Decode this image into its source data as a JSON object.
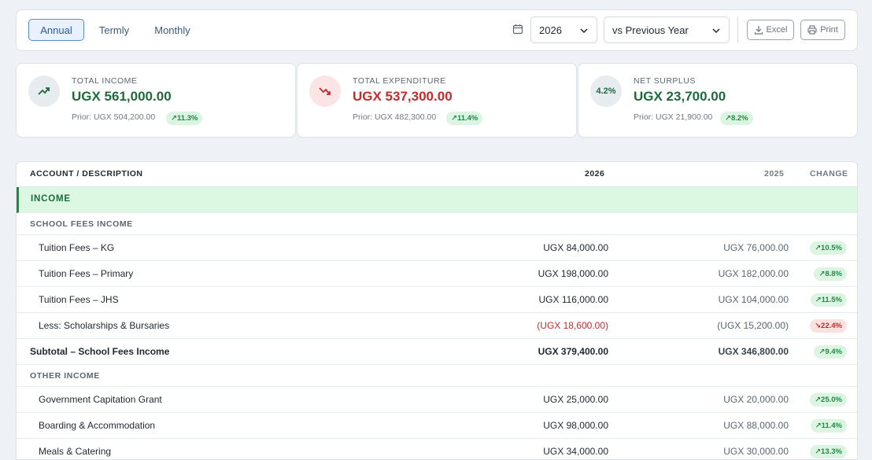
{
  "toolbar": {
    "periods": [
      "Annual",
      "Termly",
      "Monthly"
    ],
    "year": "2026",
    "compare": "vs Previous Year",
    "excel": "Excel",
    "print": "Print"
  },
  "cards": [
    {
      "label": "TOTAL INCOME",
      "amount": "UGX 561,000.00",
      "prior": "Prior: UGX 504,200.00",
      "change": "↗11.3%",
      "color": "#1f8a46"
    },
    {
      "label": "TOTAL EXPENDITURE",
      "amount": "UGX 537,300.00",
      "prior": "Prior: UGX 482,300.00",
      "change": "↗11.4%",
      "color": "#c8292d"
    },
    {
      "label": "NET SURPLUS",
      "circle_text": "4.2%",
      "amount": "UGX 23,700.00",
      "prior": "Prior: UGX 21,900.00",
      "change": "↗8.2%",
      "color": "#1f8a46"
    }
  ],
  "table": {
    "headers": {
      "account": "ACCOUNT / DESCRIPTION",
      "current": "2026",
      "previous": "2025",
      "change": "CHANGE"
    },
    "category": "INCOME",
    "groups": {
      "school_fees": "SCHOOL FEES INCOME",
      "other": "OTHER INCOME"
    },
    "rows": [
      {
        "name": "Tuition Fees – KG",
        "current": "UGX 84,000.00",
        "previous": "UGX 76,000.00",
        "change": "↗10.5%"
      },
      {
        "name": "Tuition Fees – Primary",
        "current": "UGX 198,000.00",
        "previous": "UGX 182,000.00",
        "change": "↗8.8%"
      },
      {
        "name": "Tuition Fees – JHS",
        "current": "UGX 116,000.00",
        "previous": "UGX 104,000.00",
        "change": "↗11.5%"
      },
      {
        "name": "Less: Scholarships & Bursaries",
        "current": "(UGX 18,600.00)",
        "previous": "(UGX 15,200.00)",
        "change": "↘22.4%"
      },
      {
        "name": "Subtotal – School Fees Income",
        "current": "UGX 379,400.00",
        "previous": "UGX 346,800.00",
        "change": "↗9.4%"
      },
      {
        "name": "Government Capitation Grant",
        "current": "UGX 25,000.00",
        "previous": "UGX 20,000.00",
        "change": "↗25.0%"
      },
      {
        "name": "Boarding & Accommodation",
        "current": "UGX 98,000.00",
        "previous": "UGX 88,000.00",
        "change": "↗11.4%"
      },
      {
        "name": "Meals & Catering",
        "current": "UGX 34,000.00",
        "previous": "UGX 30,000.00",
        "change": "↗13.3%"
      }
    ]
  }
}
